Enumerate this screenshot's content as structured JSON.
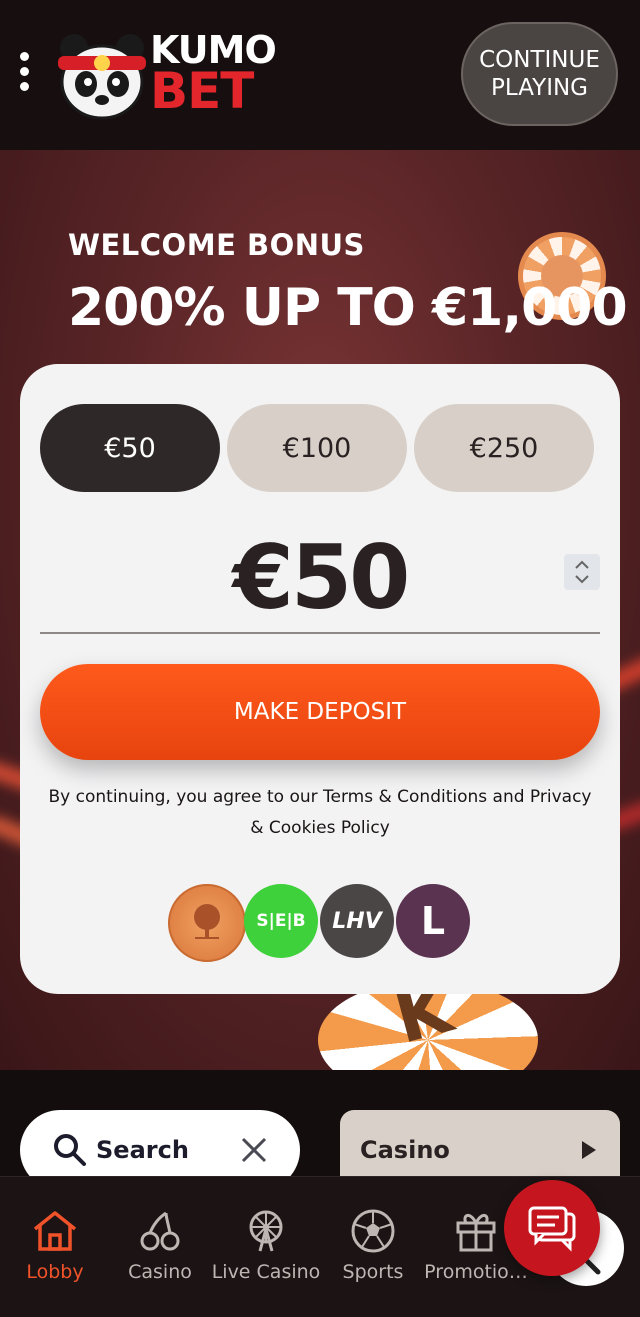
{
  "header": {
    "logo_top": "KUMO",
    "logo_bottom": "BET",
    "continue_label_line1": "CONTINUE",
    "continue_label_line2": "PLAYING"
  },
  "hero": {
    "bonus_label": "WELCOME BONUS",
    "bonus_offer": "200% UP TO €1,000"
  },
  "deposit": {
    "amounts": [
      "€50",
      "€100",
      "€250"
    ],
    "selected_index": 0,
    "value": "€50",
    "button_label": "MAKE DEPOSIT",
    "terms": "By continuing, you agree to our Terms & Conditions and Privacy & Cookies Policy",
    "payment_methods": [
      {
        "name": "swedbank",
        "label": "",
        "color": "#e88a4a"
      },
      {
        "name": "seb",
        "label": "S|E|B",
        "color": "#3fd13b"
      },
      {
        "name": "lhv",
        "label": "LHV",
        "color": "#4b4646"
      },
      {
        "name": "luminor",
        "label": "L",
        "color": "#5a3350"
      }
    ]
  },
  "filters": {
    "search_label": "Search",
    "category_label": "Casino"
  },
  "bottom_nav": {
    "items": [
      {
        "label": "Lobby",
        "icon": "home-icon",
        "active": true
      },
      {
        "label": "Casino",
        "icon": "cherries-icon",
        "active": false
      },
      {
        "label": "Live Casino",
        "icon": "ferris-wheel-icon",
        "active": false
      },
      {
        "label": "Sports",
        "icon": "soccer-ball-icon",
        "active": false
      },
      {
        "label": "Promotio…",
        "icon": "gift-icon",
        "active": false
      }
    ]
  },
  "colors": {
    "accent": "#f0522a",
    "deposit_button": "#e7430e",
    "chat_button": "#c5161f",
    "selected_amount": "#2f2828",
    "unselected_amount": "#d8d0c8"
  }
}
